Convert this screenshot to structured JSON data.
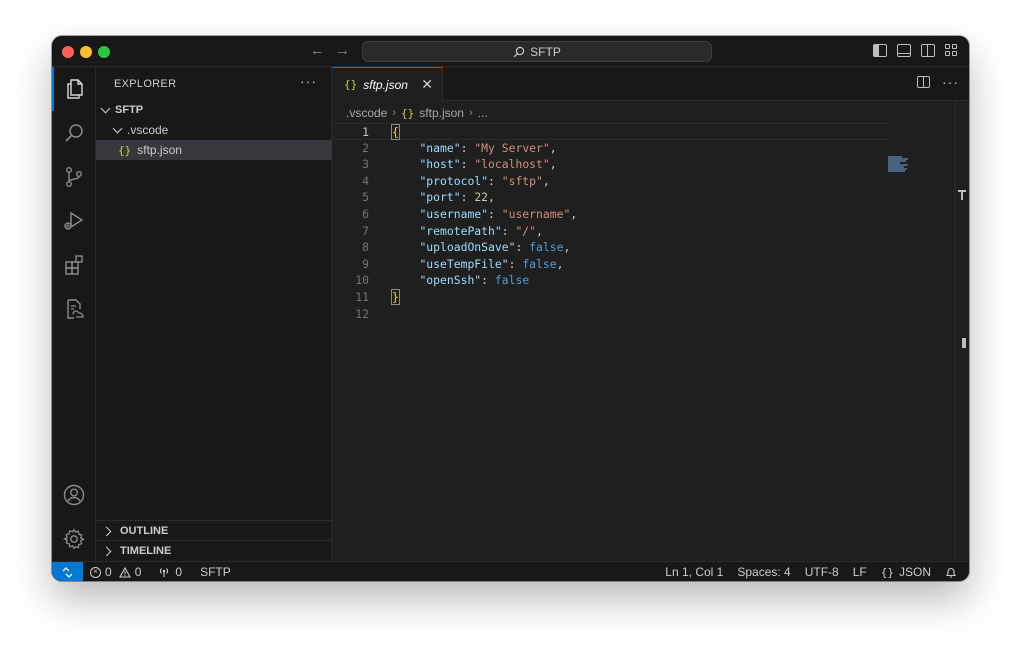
{
  "titlebar": {
    "search_text": "SFTP"
  },
  "sidebar": {
    "title": "EXPLORER",
    "more": "···",
    "root_folder": "SFTP",
    "subfolder": ".vscode",
    "file": "sftp.json",
    "file_glyph": "{}",
    "outline_label": "OUTLINE",
    "timeline_label": "TIMELINE"
  },
  "editor": {
    "tab_label": "sftp.json",
    "tab_glyph": "{}",
    "tab_close": "✕",
    "more": "···",
    "breadcrumb": {
      "folder": ".vscode",
      "file": "sftp.json",
      "tail": "..."
    },
    "lines": [
      {
        "n": "1"
      },
      {
        "n": "2"
      },
      {
        "n": "3"
      },
      {
        "n": "4"
      },
      {
        "n": "5"
      },
      {
        "n": "6"
      },
      {
        "n": "7"
      },
      {
        "n": "8"
      },
      {
        "n": "9"
      },
      {
        "n": "10"
      },
      {
        "n": "11"
      },
      {
        "n": "12"
      }
    ],
    "json": {
      "open": "{",
      "close": "}",
      "entries": [
        {
          "key": "\"name\"",
          "value": "\"My Server\"",
          "type": "str",
          "comma": ","
        },
        {
          "key": "\"host\"",
          "value": "\"localhost\"",
          "type": "str",
          "comma": ","
        },
        {
          "key": "\"protocol\"",
          "value": "\"sftp\"",
          "type": "str",
          "comma": ","
        },
        {
          "key": "\"port\"",
          "value": "22",
          "type": "num",
          "comma": ","
        },
        {
          "key": "\"username\"",
          "value": "\"username\"",
          "type": "str",
          "comma": ","
        },
        {
          "key": "\"remotePath\"",
          "value": "\"/\"",
          "type": "str",
          "comma": ","
        },
        {
          "key": "\"uploadOnSave\"",
          "value": "false",
          "type": "bool",
          "comma": ","
        },
        {
          "key": "\"useTempFile\"",
          "value": "false",
          "type": "bool",
          "comma": ","
        },
        {
          "key": "\"openSsh\"",
          "value": "false",
          "type": "bool",
          "comma": ""
        }
      ]
    }
  },
  "statusbar": {
    "errors": "0",
    "warnings": "0",
    "ports": "0",
    "remote_name": "SFTP",
    "position": "Ln 1, Col 1",
    "spaces": "Spaces: 4",
    "encoding": "UTF-8",
    "eol": "LF",
    "language": "JSON",
    "language_glyph": "{}"
  },
  "colors": {
    "accent": "#0078d4",
    "json_icon": "#cbcb41"
  }
}
